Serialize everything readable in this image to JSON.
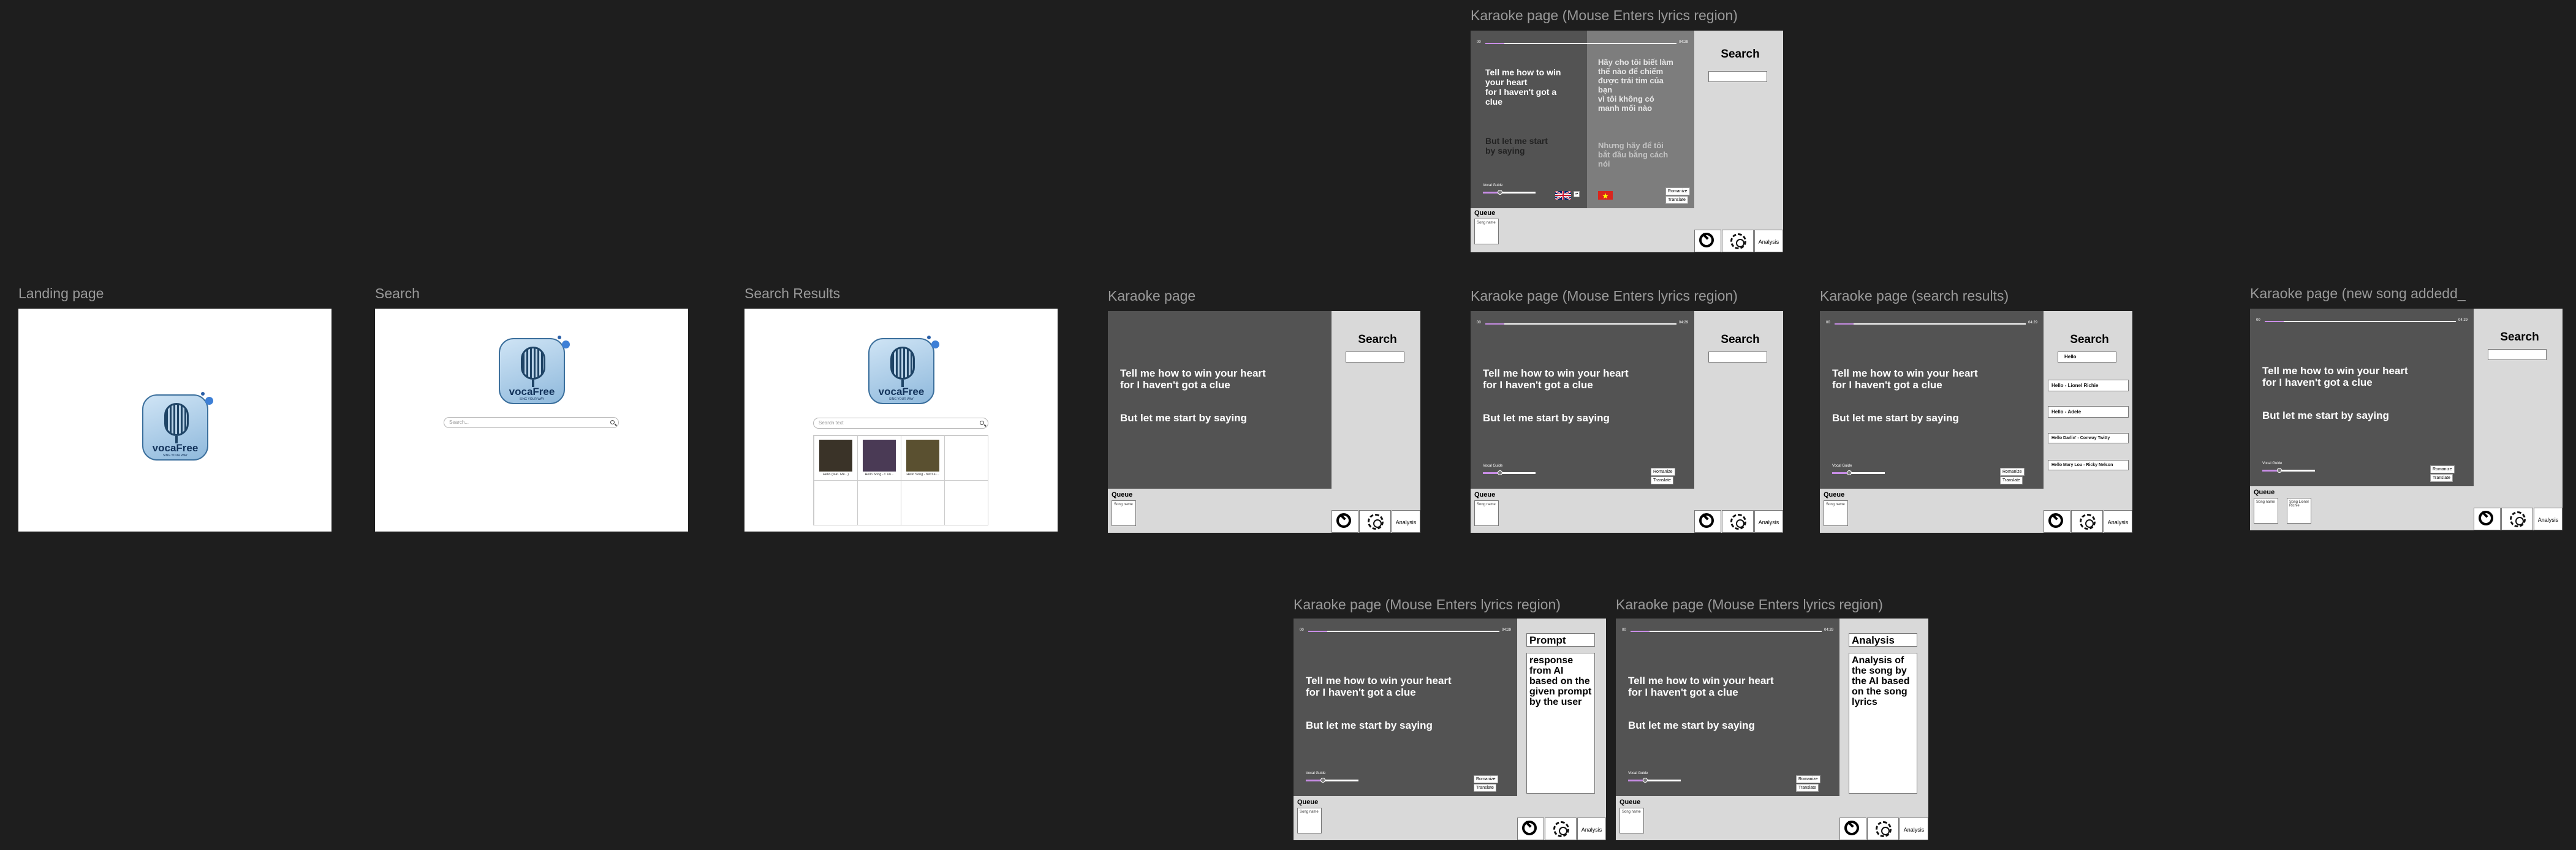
{
  "frames": {
    "landing": {
      "label": "Landing page"
    },
    "search": {
      "label": "Search",
      "placeholder": "Search..."
    },
    "results": {
      "label": "Search Results",
      "placeholder": "Search text",
      "items": [
        {
          "caption": "Hello (feat. Me...)"
        },
        {
          "caption": "Hello Song - f. un..."
        },
        {
          "caption": "Hello Song - bet tuu..."
        }
      ]
    },
    "karaoke": {
      "label": "Karaoke page"
    },
    "hover": {
      "label": "Karaoke page (Mouse Enters lyrics region)"
    },
    "searchres": {
      "label": "Karaoke page (search results)",
      "query": "Hello",
      "results": [
        "Hello - Lionel Richie",
        "Hello - Adele",
        "Hello Darlin' - Conway Twitty",
        "Hello Mary Lou - Ricky Nelson"
      ]
    },
    "newsong": {
      "label": "Karaoke page (new song addedd_",
      "new_card": "Song Lionel Richie"
    },
    "translate": {
      "label": "Karaoke page (Mouse Enters lyrics region)",
      "lyrics_en_1": [
        "Tell me how to win",
        "your heart",
        "for I haven't got a",
        "clue"
      ],
      "lyrics_en_2": [
        "But let me start",
        "by saying"
      ],
      "lyrics_vi_1": [
        "Hãy cho tôi biết làm",
        "thế nào để chiếm",
        "được trái tim của",
        "bạn",
        "vì tôi không có",
        "manh mối nào"
      ],
      "lyrics_vi_2": [
        "Nhưng hãy để tôi",
        "bắt đầu bằng cách",
        "nói"
      ]
    },
    "prompt": {
      "label": "Karaoke page (Mouse Enters lyrics region)",
      "title": "Prompt",
      "body": [
        "response",
        "from AI",
        "based on the",
        "given prompt",
        "by the user"
      ]
    },
    "analysis": {
      "label": "Karaoke page (Mouse Enters lyrics region)",
      "title": "Analysis",
      "body": [
        "Analysis of",
        "the song by",
        "the AI based",
        "on the song",
        "lyrics"
      ]
    }
  },
  "common": {
    "logo_word": "vocaFree",
    "logo_sub": "SING YOUR WAY",
    "lyric_line_1": "Tell me how to win your heart",
    "lyric_line_2": "for I haven't got a clue",
    "lyric_line_3": "But let me start by saying",
    "time_start": "00",
    "time_end": "04:29",
    "vocal_guide": "Vocal Guide",
    "romanize": "Romanize",
    "translate": "Translate",
    "queue": "Queue",
    "song_name": "Song name",
    "search_title": "Search",
    "analysis_btn": "Analysis"
  },
  "icons": [
    "search-icon",
    "settings-gear-icon",
    "microphone-icon",
    "uk-flag-icon",
    "vietnam-flag-icon"
  ]
}
